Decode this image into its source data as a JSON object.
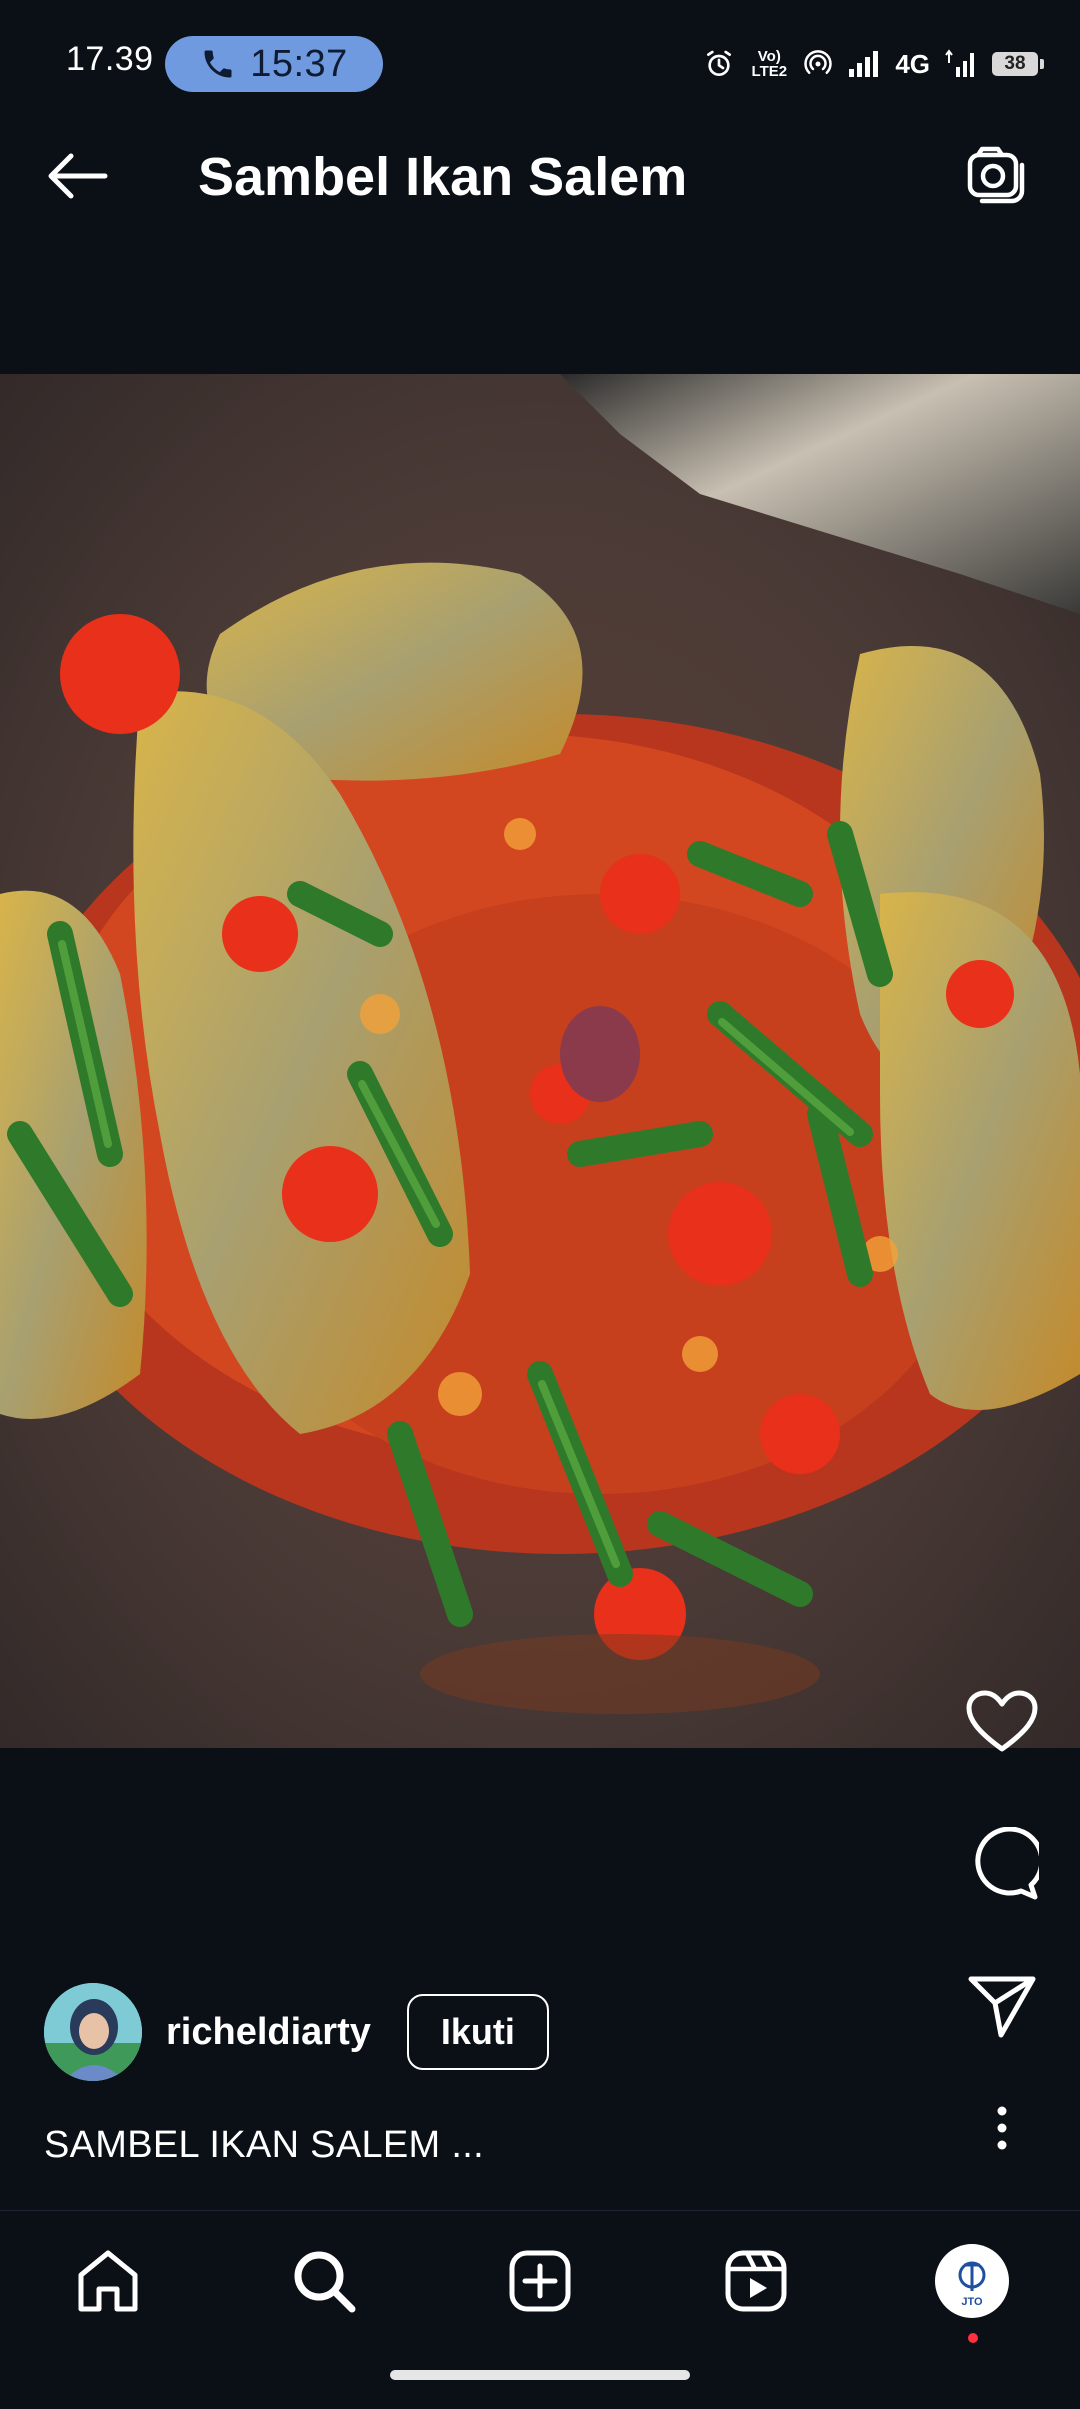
{
  "status_bar": {
    "time": "17.39",
    "call_duration": "15:37",
    "volte_label": "Vo) LTE2",
    "network": "4G",
    "battery": "38"
  },
  "header": {
    "title": "Sambel Ikan Salem",
    "back_icon": "arrow-left-icon",
    "camera_icon": "camera-icon"
  },
  "media": {
    "description_icon": "food-photo"
  },
  "actions": {
    "like_icon": "heart-outline-icon",
    "comment_icon": "comment-bubble-icon",
    "share_icon": "paper-plane-icon",
    "more_icon": "more-vertical-icon"
  },
  "post": {
    "username": "richeldiarty",
    "follow_label": "Ikuti",
    "caption": "SAMBEL IKAN SALEM ..."
  },
  "bottom_nav": {
    "items": [
      {
        "icon": "home-icon"
      },
      {
        "icon": "search-icon"
      },
      {
        "icon": "create-post-icon"
      },
      {
        "icon": "reels-icon"
      },
      {
        "icon": "profile-avatar-icon"
      }
    ],
    "profile_logo_text": "JTO"
  },
  "colors": {
    "background": "#0b0f16",
    "call_pill": "#6f9ae0",
    "notification_dot": "#ff3040"
  }
}
